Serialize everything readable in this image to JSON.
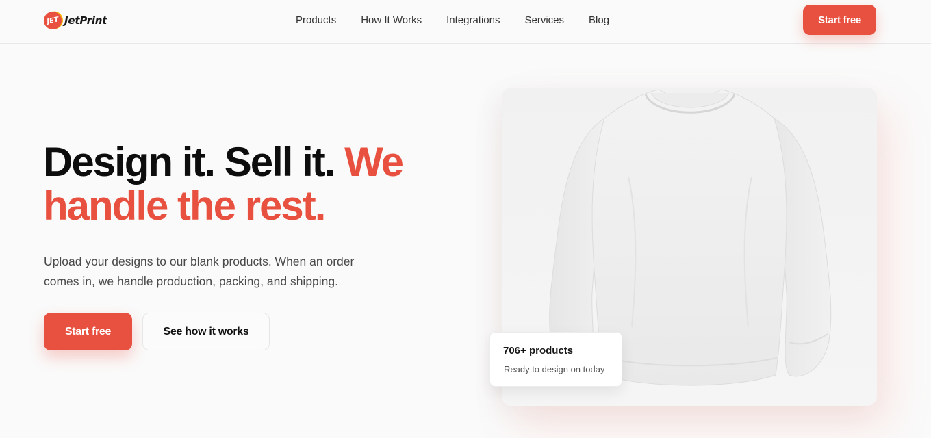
{
  "brand": {
    "name": "JetPrint",
    "badge_text": "JET",
    "accent_color": "#e8503f"
  },
  "nav": {
    "items": [
      "Products",
      "How It Works",
      "Integrations",
      "Services",
      "Blog"
    ],
    "cta_label": "Start free"
  },
  "hero": {
    "headline_part1": "Design it. Sell it.",
    "headline_accent": "We handle the rest.",
    "subtext": "Upload your designs to our blank products. When an order comes in, we handle production, packing, and shipping.",
    "primary_cta": "Start free",
    "secondary_cta": "See how it works"
  },
  "product_image": {
    "icon": "sweatshirt-image"
  },
  "stat_card": {
    "title": "706+ products",
    "subtitle": "Ready to design on today"
  }
}
